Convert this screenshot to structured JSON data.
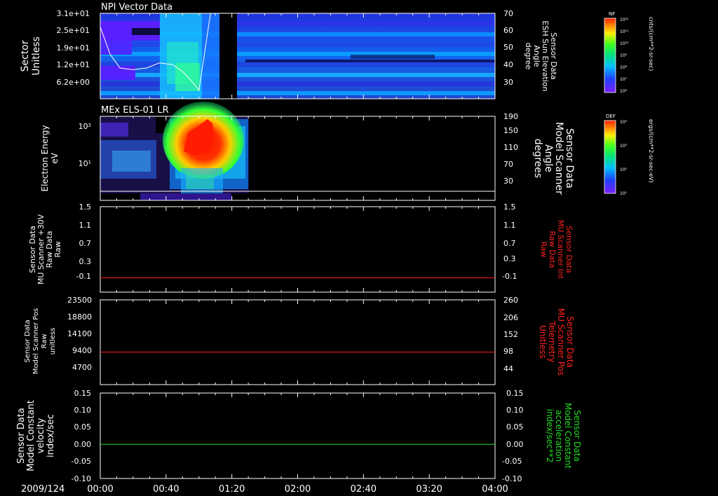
{
  "date_label": "2009/124",
  "time_ticks": [
    "00:00",
    "00:40",
    "01:20",
    "02:00",
    "02:40",
    "03:20",
    "04:00"
  ],
  "colors": {
    "frame": "#ffffff",
    "red": "#ff2020",
    "green": "#22dd22",
    "black": "#000000"
  },
  "panels": [
    {
      "id": "p1",
      "title": "NPI Vector Data",
      "left_label": [
        "Sector",
        "Unitless"
      ],
      "left_ticks": [
        "3.1e+01",
        "2.5e+01",
        "1.9e+01",
        "1.2e+01",
        "6.2e+00"
      ],
      "right_label": [
        "Sensor Data",
        "ESH Sun Elevation",
        "Angle",
        "degree"
      ],
      "right_ticks": [
        "70",
        "60",
        "50",
        "40",
        "30"
      ],
      "colorbar": {
        "label": "NF",
        "unit": "cnts/(cm**2-sr-sec)",
        "ticks": [
          "10¹²",
          "10¹¹",
          "10¹⁰",
          "10⁹",
          "10⁸",
          "10⁷",
          "10⁶"
        ]
      }
    },
    {
      "id": "p2",
      "title": "MEx ELS-01 LR",
      "left_label": [
        "Electron Energy",
        "eV"
      ],
      "left_ticks": [
        "10²",
        "10¹"
      ],
      "right_label": [
        "Sensor Data",
        "Model Scanner",
        "Angle",
        "degrees"
      ],
      "right_ticks": [
        "190",
        "150",
        "110",
        "70",
        "30"
      ],
      "colorbar": {
        "label": "DEF",
        "unit": "ergs/(cm**2-sr-sec-eV)",
        "ticks": [
          "10⁴",
          "10³",
          "10²",
          "10¹"
        ]
      }
    },
    {
      "id": "p3",
      "left_label": [
        "Sensor Data",
        "MU Scanner +30V",
        "Raw Data",
        "Raw"
      ],
      "left_ticks": [
        "1.5",
        "1.1",
        "0.7",
        "0.3",
        "-0.1"
      ],
      "right_label": [
        "Sensor Data",
        "MU Scanner Int",
        "Raw Data",
        "Raw"
      ],
      "right_ticks": [
        "1.5",
        "1.1",
        "0.7",
        "0.3",
        "-0.1"
      ]
    },
    {
      "id": "p4",
      "left_label": [
        "Sensor Data",
        "Model Scanner Pos",
        "Raw",
        "unitless"
      ],
      "left_ticks": [
        "23500",
        "18800",
        "14100",
        "9400",
        "4700"
      ],
      "right_label": [
        "Sensor Data",
        "MU Scanner Pos",
        "Telemetry",
        "Unitless"
      ],
      "right_ticks": [
        "260",
        "206",
        "152",
        "98",
        "44"
      ]
    },
    {
      "id": "p5",
      "left_label": [
        "Sensor Data",
        "Model Constant",
        "velocity",
        "index/sec"
      ],
      "left_ticks": [
        "0.15",
        "0.10",
        "0.05",
        "0.00",
        "-0.05",
        "-0.10"
      ],
      "right_label": [
        "Sensor Data",
        "Model Constant",
        "acceleration",
        "index/sec**2"
      ],
      "right_ticks": [
        "0.15",
        "0.10",
        "0.05",
        "0.00",
        "-0.05",
        "-0.10"
      ]
    }
  ],
  "chart_data": [
    {
      "type": "heatmap",
      "panel": "p1",
      "title": "NPI Vector Data",
      "x_range": [
        "00:00",
        "04:00"
      ],
      "ylabel": "Sector Unitless",
      "ylim_left": [
        0,
        31
      ],
      "y2label": "Sensor Data ESH Sun Elevation Angle degree",
      "ylim_right": [
        20,
        70
      ],
      "overlay_line": {
        "name": "ESH Sun Elevation",
        "x_min": [
          0,
          6,
          12,
          20,
          28,
          36,
          44,
          50,
          55,
          60,
          67,
          78
        ],
        "y": [
          62,
          46,
          38,
          37,
          38,
          41,
          40,
          36,
          31,
          25,
          70,
          70
        ]
      },
      "data_gap_min": [
        70,
        80
      ]
    },
    {
      "type": "heatmap",
      "panel": "p2",
      "title": "MEx ELS-01 LR",
      "x_range": [
        "00:00",
        "04:00"
      ],
      "ylabel": "Electron Energy eV",
      "y_scale": "log",
      "y2label": "Sensor Data Model Scanner Angle degrees",
      "ylim_right": [
        10,
        190
      ],
      "data_end_min": 85,
      "peak_time_min": [
        45,
        70
      ],
      "scanner_angle_line": 20
    },
    {
      "type": "line",
      "panel": "p3",
      "series": [
        {
          "name": "MU Scanner +30V Raw",
          "axis": "left",
          "color": "red",
          "value": 0.0
        }
      ],
      "ylim": [
        -0.3,
        1.5
      ]
    },
    {
      "type": "line",
      "panel": "p4",
      "series": [
        {
          "name": "MU Scanner Pos Telemetry",
          "axis": "left",
          "color": "red",
          "value": 9000
        }
      ],
      "ylim": [
        0,
        23500
      ],
      "ylim_right": [
        20,
        260
      ]
    },
    {
      "type": "line",
      "panel": "p5",
      "series": [
        {
          "name": "Model Constant velocity",
          "axis": "left",
          "color": "green",
          "value": 0.0
        }
      ],
      "ylim": [
        -0.1,
        0.15
      ]
    }
  ]
}
